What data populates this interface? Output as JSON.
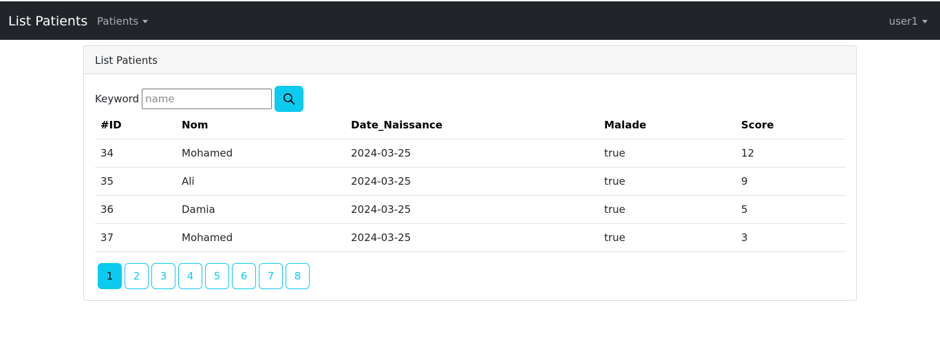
{
  "navbar": {
    "brand": "List Patients",
    "menu_label": "Patients",
    "user_label": "user1"
  },
  "card": {
    "header": "List Patients",
    "search": {
      "label": "Keyword",
      "placeholder": "name",
      "value": ""
    }
  },
  "table": {
    "columns": [
      "#ID",
      "Nom",
      "Date_Naissance",
      "Malade",
      "Score"
    ],
    "rows": [
      [
        "34",
        "Mohamed",
        "2024-03-25",
        "true",
        "12"
      ],
      [
        "35",
        "Ali",
        "2024-03-25",
        "true",
        "9"
      ],
      [
        "36",
        "Damia",
        "2024-03-25",
        "true",
        "5"
      ],
      [
        "37",
        "Mohamed",
        "2024-03-25",
        "true",
        "3"
      ]
    ]
  },
  "pagination": {
    "pages": [
      "1",
      "2",
      "3",
      "4",
      "5",
      "6",
      "7",
      "8"
    ],
    "active_index": 0
  },
  "colors": {
    "navbar_bg": "#212529",
    "accent": "#0dcaf0"
  }
}
